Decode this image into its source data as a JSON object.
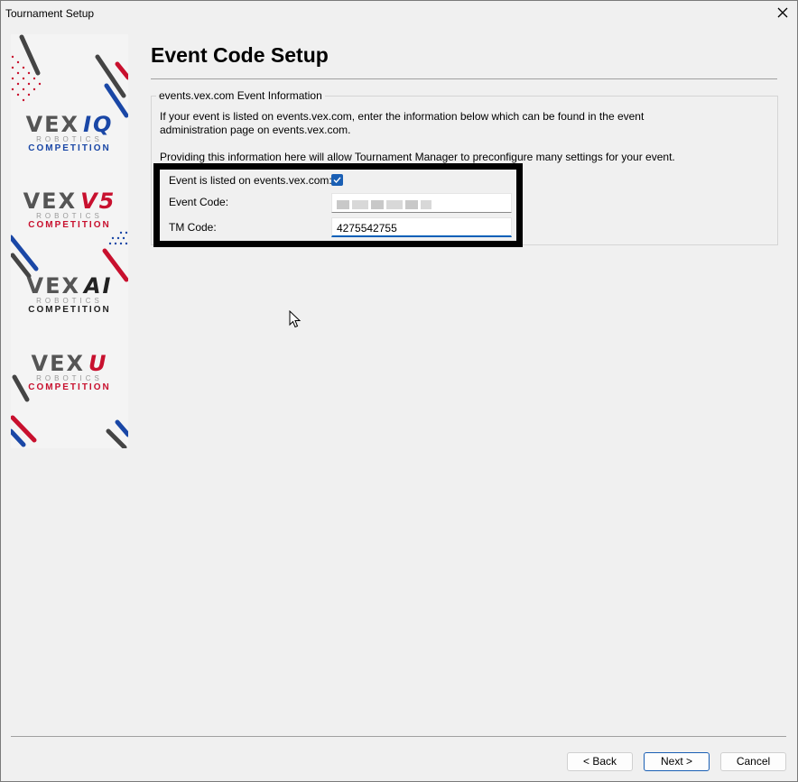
{
  "window": {
    "title": "Tournament Setup"
  },
  "banner": {
    "logos": [
      {
        "brand": "VEX",
        "program": "IQ",
        "robotics": "ROBOTICS",
        "competition": "COMPETITION",
        "color": "#1a47a6"
      },
      {
        "brand": "VEX",
        "program": "V5",
        "robotics": "ROBOTICS",
        "competition": "COMPETITION",
        "color": "#c8102e"
      },
      {
        "brand": "VEX",
        "program": "AI",
        "robotics": "ROBOTICS",
        "competition": "COMPETITION",
        "color": "#222222"
      },
      {
        "brand": "VEX",
        "program": "U",
        "robotics": "ROBOTICS",
        "competition": "COMPETITION",
        "color": "#c8102e"
      }
    ]
  },
  "page": {
    "heading": "Event Code Setup",
    "group_title": "events.vex.com Event Information",
    "para1_line1": "If your event is listed on events.vex.com, enter the information below which can be found in the event",
    "para1_line2": "administration page on events.vex.com.",
    "para2": "Providing this information here will allow Tournament Manager to preconfigure many settings for your event.",
    "listed_label": "Event is listed on events.vex.com:",
    "listed_checked": true,
    "event_code_label": "Event Code:",
    "event_code_value": "",
    "tm_code_label": "TM Code:",
    "tm_code_value": "4275542755"
  },
  "footer": {
    "back_label": "< Back",
    "next_label": "Next >",
    "cancel_label": "Cancel"
  },
  "colors": {
    "accent": "#005fb8",
    "checkbox": "#1a5fb4",
    "vex_red": "#c8102e",
    "vex_blue": "#1a47a6"
  }
}
